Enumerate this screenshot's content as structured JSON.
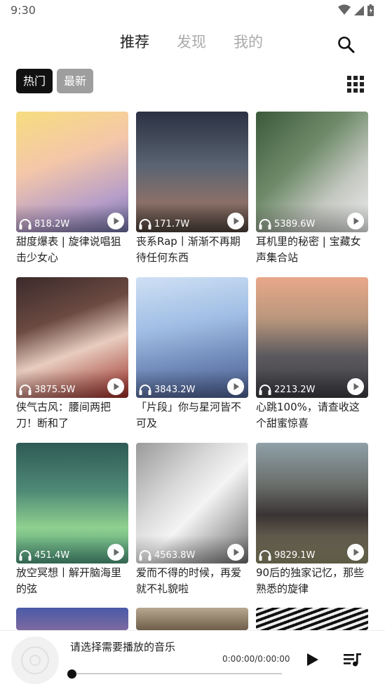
{
  "status_bar": {
    "time": "9:30"
  },
  "nav": {
    "tabs": [
      {
        "label": "推荐",
        "active": true
      },
      {
        "label": "发现",
        "active": false
      },
      {
        "label": "我的",
        "active": false
      }
    ]
  },
  "sub_tabs": [
    {
      "label": "热门",
      "active": true
    },
    {
      "label": "最新",
      "active": false
    }
  ],
  "cards": [
    {
      "plays": "818.2W",
      "title": "甜度爆表 | 旋律说唱狙击少女心"
    },
    {
      "plays": "171.7W",
      "title": "丧系Rap丨渐渐不再期待任何东西"
    },
    {
      "plays": "5389.6W",
      "title": "耳机里的秘密 | 宝藏女声集合站"
    },
    {
      "plays": "3875.5W",
      "title": "侠气古风：腰间两把刀！断和了"
    },
    {
      "plays": "3843.2W",
      "title": "「片段」你与星河皆不可及"
    },
    {
      "plays": "2213.2W",
      "title": "心跳100%，请查收这个甜蜜惊喜"
    },
    {
      "plays": "451.4W",
      "title": "放空冥想丨解开脑海里的弦"
    },
    {
      "plays": "4563.8W",
      "title": "爱而不得的时候，再爱就不礼貌啦"
    },
    {
      "plays": "9829.1W",
      "title": "90后的独家记忆，那些熟悉的旋律"
    }
  ],
  "player": {
    "now_playing": "请选择需要播放的音乐",
    "time": "0:00:00/0:00:00",
    "progress": 0
  },
  "icons": {
    "search": "search-icon",
    "grid": "grid-icon",
    "headphones": "headphones-icon",
    "play": "play-icon",
    "playlist": "playlist-icon"
  },
  "colors": {
    "accent": "#111111",
    "chip_inactive": "#9e9e9e"
  }
}
